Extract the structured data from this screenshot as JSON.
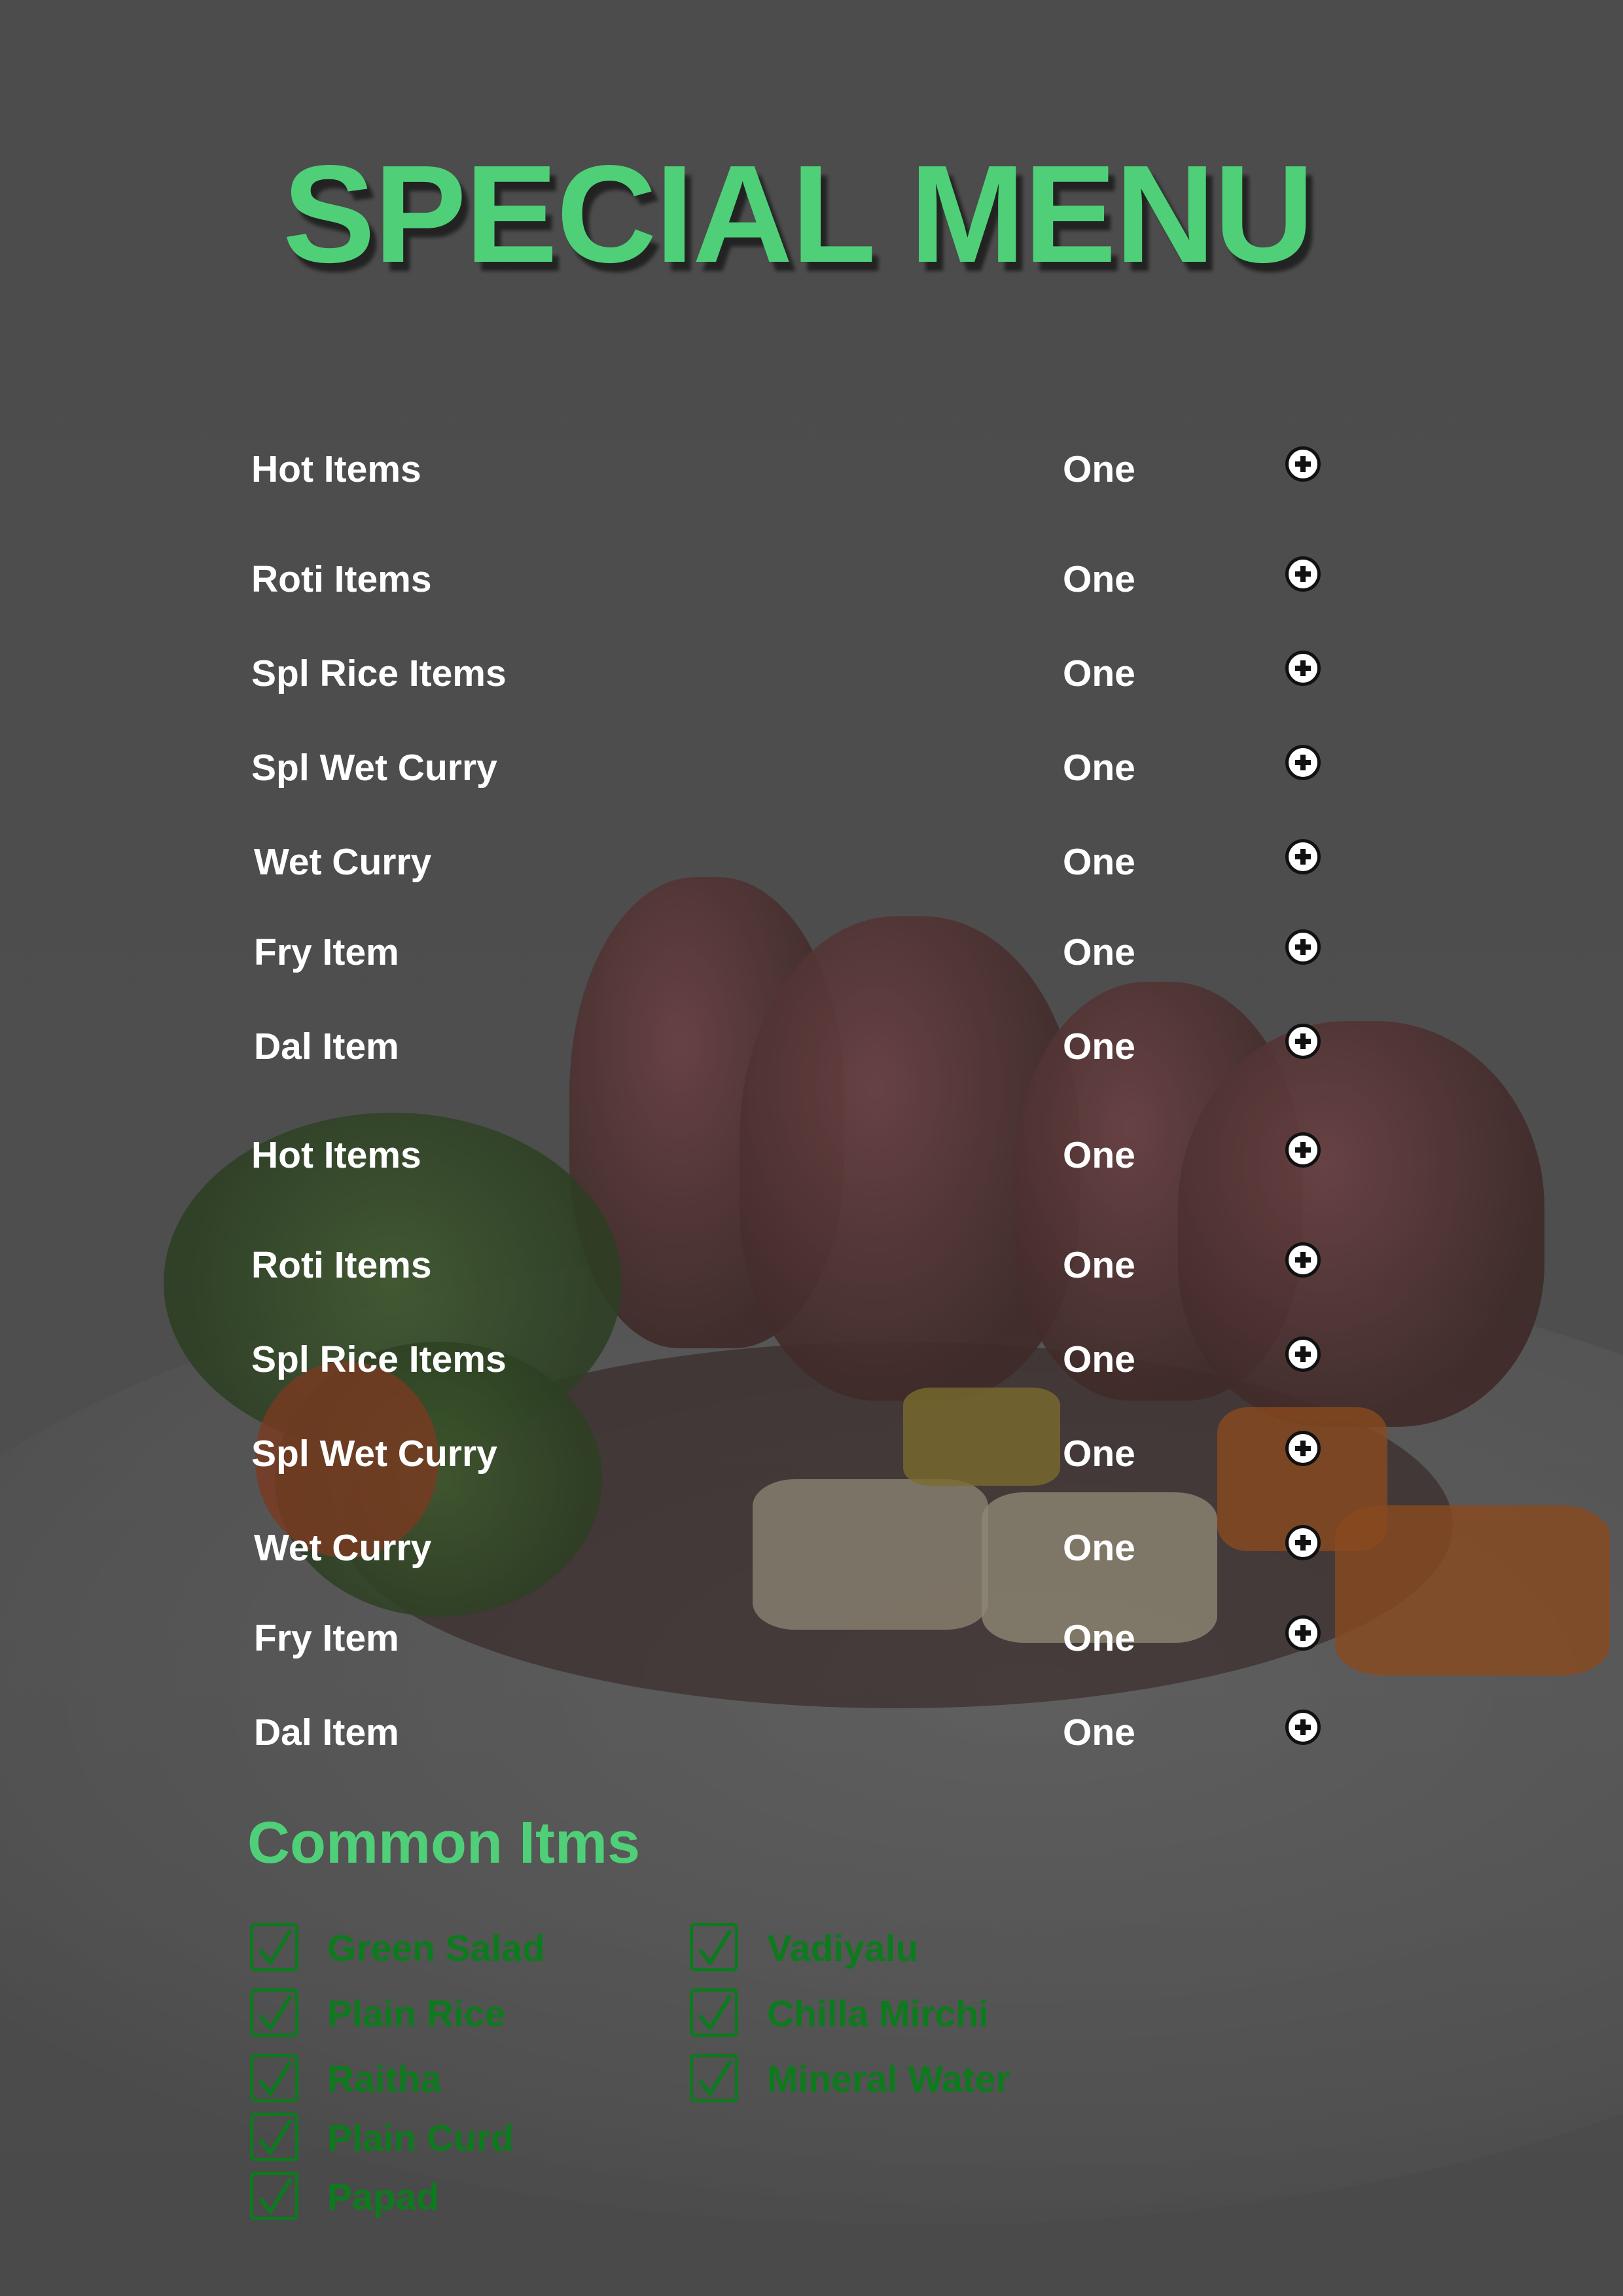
{
  "menu": {
    "title": "SPECIAL MENU",
    "accent_color": "#4fd078",
    "items": [
      {
        "name": "Hot Items",
        "qty": "One"
      },
      {
        "name": "Roti Items",
        "qty": "One"
      },
      {
        "name": "Spl Rice Items",
        "qty": "One"
      },
      {
        "name": "Spl Wet Curry",
        "qty": "One"
      },
      {
        "name": "Wet Curry",
        "qty": "One"
      },
      {
        "name": "Fry Item",
        "qty": "One"
      },
      {
        "name": "Dal Item",
        "qty": "One"
      },
      {
        "name": "Hot Items",
        "qty": "One"
      },
      {
        "name": "Roti Items",
        "qty": "One"
      },
      {
        "name": "Spl Rice Items",
        "qty": "One"
      },
      {
        "name": "Spl Wet Curry",
        "qty": "One"
      },
      {
        "name": "Wet Curry",
        "qty": "One"
      },
      {
        "name": "Fry Item",
        "qty": "One"
      },
      {
        "name": "Dal Item",
        "qty": "One"
      }
    ],
    "add_icon": "plus-circle-icon"
  },
  "common": {
    "heading": "Common Itms",
    "check_color": "#0e7a1e",
    "check_icon": "checkmark-icon",
    "left": [
      {
        "label": "Green Salad",
        "checked": true
      },
      {
        "label": "Plain Rice",
        "checked": true
      },
      {
        "label": "Raitha",
        "checked": true
      },
      {
        "label": "Plain Curd",
        "checked": true
      },
      {
        "label": "Papad",
        "checked": true
      }
    ],
    "right": [
      {
        "label": "Vadiyalu",
        "checked": true
      },
      {
        "label": "Chilla Mirchi",
        "checked": true
      },
      {
        "label": "Mineral Water",
        "checked": true
      }
    ]
  }
}
